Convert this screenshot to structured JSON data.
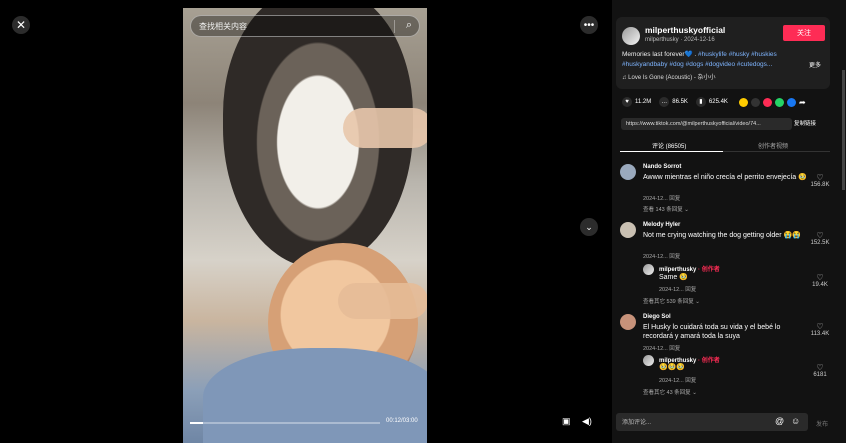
{
  "search": {
    "placeholder": "查找相关内容"
  },
  "video": {
    "time": "00:12/03:00",
    "progress_fraction": 0.067
  },
  "author": {
    "username": "milperthuskyofficial",
    "meta": "milperthusky · 2024-12-16",
    "follow_label": "关注"
  },
  "description": {
    "text": "Memories last forever💙 . ",
    "tags": "#huskylife #husky #huskies #huskyandbaby #dog #dogs #dogvideo #cutedogs...",
    "more": "更多"
  },
  "music": "♫  Love Is Gone (Acoustic) - 杂小小",
  "stats": {
    "likes": "11.2M",
    "comments": "86.5K",
    "saves": "625.4K"
  },
  "link": {
    "url": "https://www.tiktok.com/@milperthuskyofficial/video/74...",
    "copy_label": "复制链接"
  },
  "tabs": [
    {
      "label": "评论 (86505)"
    },
    {
      "label": "创作者视频"
    }
  ],
  "comments": [
    {
      "name": "Nando Sorrot",
      "text": "Awww mientras el niño crecía el perrito envejecía 🥹",
      "meta": "2024-12... 回复",
      "replies": "查看 143 条回复 ⌄",
      "likes": "156.8K"
    },
    {
      "name": "Melody Hyler",
      "text": "Not me crying watching the dog getting older 😭😭",
      "meta": "2024-12... 回复",
      "likes": "152.5K",
      "reply": {
        "name": "milperthusky",
        "badge": " · 创作者",
        "text": "Same 🥹",
        "meta": "2024-12... 回复",
        "likes": "19.4K"
      },
      "replies": "查看其它 539 条回复 ⌄"
    },
    {
      "name": "Diego Sol",
      "text": "El Husky lo cuidará toda su vida y el bebé lo recordará y amará toda la suya",
      "meta": "2024-12... 回复",
      "likes": "113.4K",
      "reply": {
        "name": "milperthusky",
        "badge": " · 创作者",
        "text": "🥹🥹🥹",
        "meta": "2024-12... 回复",
        "likes": "6181"
      },
      "replies": "查看其它 43 条回复 ⌄"
    }
  ],
  "composer": {
    "placeholder": "添加评论...",
    "post_label": "发布"
  }
}
